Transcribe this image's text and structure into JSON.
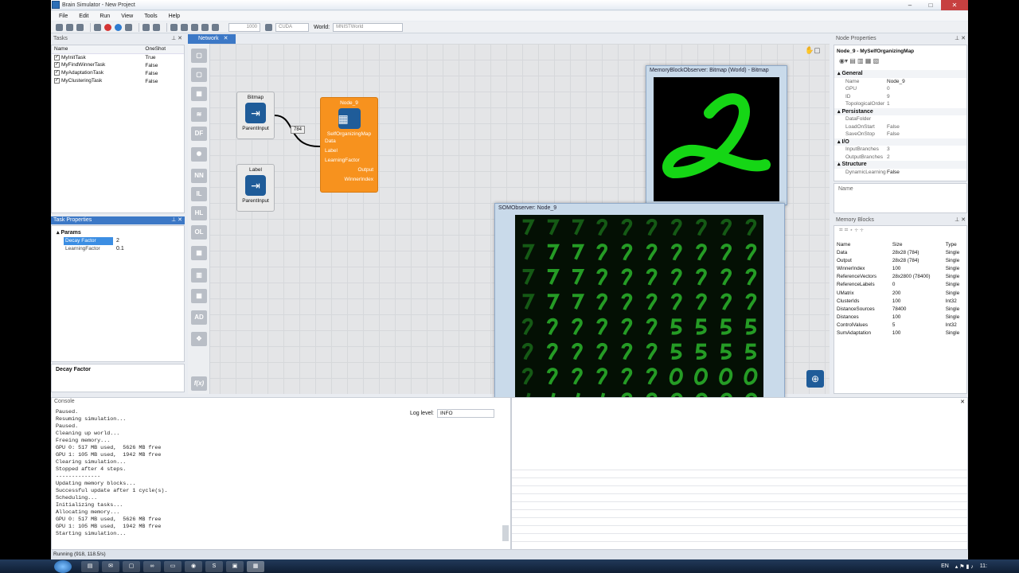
{
  "app": {
    "title": "Brain Simulator - New Project"
  },
  "menu": [
    "File",
    "Edit",
    "Run",
    "View",
    "Tools",
    "Help"
  ],
  "toolbar": {
    "steps_value": "1000",
    "device": "CUDA",
    "world_label": "World:",
    "world_value": "MNISTWorld"
  },
  "tasks": {
    "header": "Tasks",
    "col_name": "Name",
    "col_oneshot": "OneShot",
    "rows": [
      {
        "name": "MyInitTask",
        "oneshot": "True"
      },
      {
        "name": "MyFindWinnerTask",
        "oneshot": "False"
      },
      {
        "name": "MyAdaptationTask",
        "oneshot": "False"
      },
      {
        "name": "MyClusteringTask",
        "oneshot": "False"
      }
    ]
  },
  "task_properties": {
    "header": "Task Properties",
    "group": "Params",
    "rows": [
      {
        "name": "Decay Factor",
        "value": "2"
      },
      {
        "name": "LearningFactor",
        "value": "0.1"
      }
    ],
    "desc_title": "Decay Factor"
  },
  "network_tab": {
    "label": "Network"
  },
  "palette": [
    "",
    "",
    "",
    "",
    "DF",
    "",
    "NN",
    "IL",
    "HL",
    "OL",
    "",
    "",
    "",
    "AD",
    "",
    "f(x)"
  ],
  "nodes": {
    "bitmap": {
      "title": "Bitmap",
      "port": "ParentInput"
    },
    "label": {
      "title": "Label",
      "port": "ParentInput"
    },
    "som": {
      "title": "Node_9",
      "type": "SelfOrganizingMap",
      "inputs": [
        "Data",
        "Label",
        "LearningFactor"
      ],
      "outputs": [
        "Output",
        "WinnerIndex"
      ]
    },
    "edge_label": "784"
  },
  "bitmap_observer": {
    "title": "MemoryBlockObserver: Bitmap (World) - Bitmap"
  },
  "som_observer": {
    "title": "SOMObserver: Node_9",
    "grid": 10
  },
  "node_properties": {
    "header": "Node Properties",
    "subtitle": "Node_9 - MySelfOrganizingMap",
    "groups": [
      {
        "name": "General",
        "rows": [
          [
            "Name",
            "Node_9"
          ],
          [
            "GPU",
            "0"
          ],
          [
            "ID",
            "9"
          ],
          [
            "TopologicalOrder",
            "1"
          ]
        ]
      },
      {
        "name": "Persistance",
        "rows": [
          [
            "DataFolder",
            ""
          ],
          [
            "LoadOnStart",
            "False"
          ],
          [
            "SaveOnStop",
            "False"
          ]
        ]
      },
      {
        "name": "I/O",
        "rows": [
          [
            "InputBranches",
            "3"
          ],
          [
            "OutputBranches",
            "2"
          ]
        ]
      },
      {
        "name": "Structure",
        "rows": [
          [
            "DynamicLearning",
            "False"
          ]
        ]
      }
    ],
    "desc_title": "Name"
  },
  "memory_blocks": {
    "header": "Memory Blocks",
    "cols": [
      "Name",
      "Size",
      "Type"
    ],
    "rows": [
      [
        "Data",
        "28x28 (784)",
        "Single"
      ],
      [
        "Output",
        "28x28 (784)",
        "Single"
      ],
      [
        "WinnerIndex",
        "100",
        "Single"
      ],
      [
        "ReferenceVectors",
        "28x2800 (78400)",
        "Single"
      ],
      [
        "ReferenceLabels",
        "0",
        "Single"
      ],
      [
        "UMatrix",
        "200",
        "Single"
      ],
      [
        "ClusterIds",
        "100",
        "Int32"
      ],
      [
        "DistanceSources",
        "78400",
        "Single"
      ],
      [
        "Distances",
        "100",
        "Single"
      ],
      [
        "ControlValues",
        "5",
        "Int32"
      ],
      [
        "SumAdaptation",
        "100",
        "Single"
      ]
    ]
  },
  "console": {
    "header": "Console",
    "log_level_label": "Log level:",
    "log_level": "INFO",
    "lines": [
      "Paused.",
      "Resuming simulation...",
      "Paused.",
      "Cleaning up world...",
      "Freeing memory...",
      "GPU 0: 517 MB used,  5626 MB free",
      "GPU 1: 105 MB used,  1942 MB free",
      "Clearing simulation...",
      "Stopped after 4 steps.",
      "--------------",
      "Updating memory blocks...",
      "Successful update after 1 cycle(s).",
      "Scheduling...",
      "Initializing tasks...",
      "Allocating memory...",
      "GPU 0: 517 MB used,  5626 MB free",
      "GPU 1: 105 MB used,  1942 MB free",
      "Starting simulation..."
    ]
  },
  "status": {
    "text": "Running (918, 118.5/s)"
  },
  "taskbar": {
    "lang": "EN",
    "time": "11:"
  }
}
